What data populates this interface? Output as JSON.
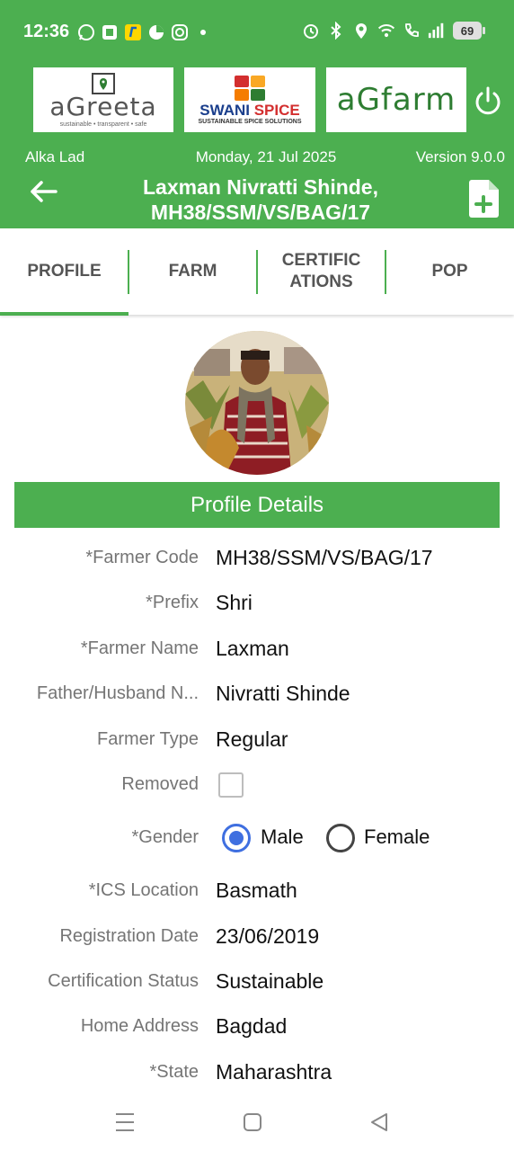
{
  "status_bar": {
    "time": "12:36",
    "battery": "69",
    "left_icons": [
      "whatsapp-icon",
      "app-icon",
      "flipkart-icon",
      "pie-icon",
      "instagram-icon",
      "dot-icon"
    ],
    "right_icons": [
      "alarm-icon",
      "bluetooth-icon",
      "location-icon",
      "wifi-icon",
      "call-icon",
      "signal-icon"
    ]
  },
  "header": {
    "logos": {
      "agreeta": {
        "name": "aGreeta",
        "tagline": "sustainable • transparent • safe"
      },
      "swani": {
        "name_part1": "SWANI",
        "name_part2": "SPICE",
        "tagline": "SUSTAINABLE SPICE SOLUTIONS"
      },
      "agfarm": {
        "name": "aGfarm"
      }
    },
    "user": "Alka Lad",
    "date": "Monday, 21 Jul 2025",
    "version": "Version 9.0.0",
    "title": "Laxman Nivratti Shinde, MH38/SSM/VS/BAG/17",
    "colors": {
      "primary": "#4caf50",
      "swani_blue": "#1a3e8c",
      "swani_red": "#d32f2f",
      "agfarm_green": "#2e7d32"
    }
  },
  "tabs": [
    {
      "label": "PROFILE",
      "active": true
    },
    {
      "label": "FARM",
      "active": false
    },
    {
      "label": "CERTIFIC ATIONS",
      "active": false
    },
    {
      "label": "POP",
      "active": false
    }
  ],
  "profile": {
    "section_title": "Profile Details",
    "fields": {
      "farmer_code": {
        "label": "*Farmer Code",
        "value": "MH38/SSM/VS/BAG/17"
      },
      "prefix": {
        "label": "*Prefix",
        "value": "Shri"
      },
      "farmer_name": {
        "label": "*Farmer Name",
        "value": "Laxman"
      },
      "father_husband": {
        "label": "Father/Husband N...",
        "value": "Nivratti Shinde"
      },
      "farmer_type": {
        "label": "Farmer Type",
        "value": "Regular"
      },
      "removed": {
        "label": "Removed",
        "checked": false
      },
      "gender": {
        "label": "*Gender",
        "options": [
          "Male",
          "Female"
        ],
        "selected": "Male"
      },
      "ics_location": {
        "label": "*ICS Location",
        "value": "Basmath"
      },
      "registration_date": {
        "label": "Registration Date",
        "value": "23/06/2019"
      },
      "certification_status": {
        "label": "Certification Status",
        "value": "Sustainable"
      },
      "home_address": {
        "label": "Home Address",
        "value": "Bagdad"
      },
      "state": {
        "label": "*State",
        "value": "Maharashtra"
      }
    }
  }
}
